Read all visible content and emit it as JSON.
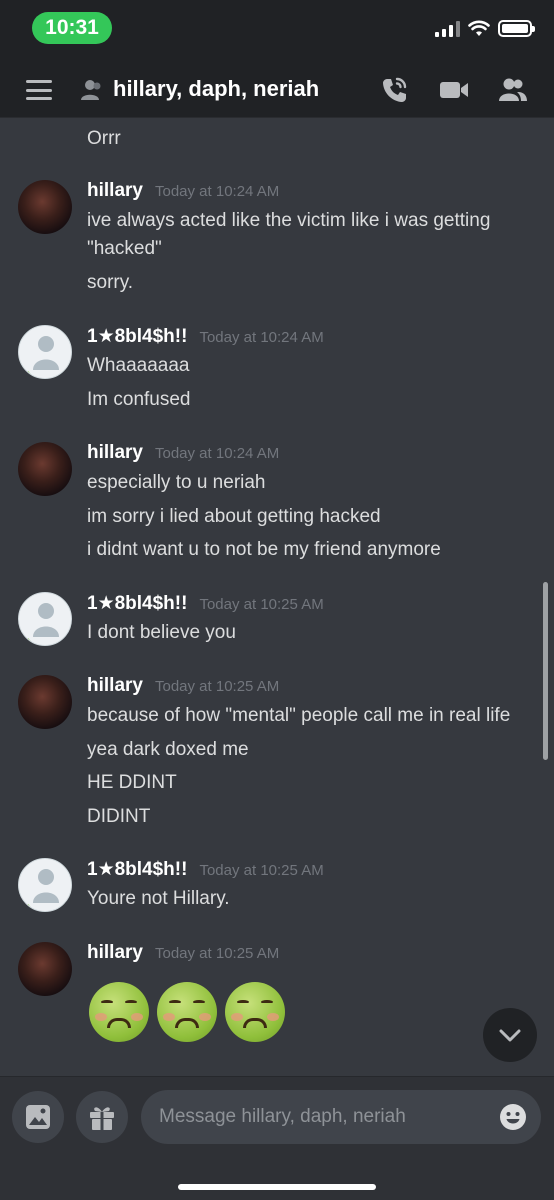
{
  "status_bar": {
    "time": "10:31"
  },
  "header": {
    "title": "hillary, daph, neriah"
  },
  "messages": {
    "continuation": "Orrr",
    "groups": [
      {
        "author": "hillary",
        "timestamp": "Today at 10:24 AM",
        "lines": [
          "ive always acted like the victim like i was getting",
          "\"hacked\"",
          "sorry."
        ]
      },
      {
        "author": "1★8bl4$h!!",
        "timestamp": "Today at 10:24 AM",
        "lines": [
          "Whaaaaaaa",
          "Im confused"
        ]
      },
      {
        "author": "hillary",
        "timestamp": "Today at 10:24 AM",
        "lines": [
          "especially to u neriah",
          "im sorry i lied about getting hacked",
          "i didnt want u to not be my friend anymore"
        ]
      },
      {
        "author": "1★8bl4$h!!",
        "timestamp": "Today at 10:25 AM",
        "lines": [
          "I dont believe you"
        ]
      },
      {
        "author": "hillary",
        "timestamp": "Today at 10:25 AM",
        "lines": [
          "because of how \"mental\" people call me in real life",
          "yea dark doxed me",
          "HE DDINT",
          "DIDINT"
        ]
      },
      {
        "author": "1★8bl4$h!!",
        "timestamp": "Today at 10:25 AM",
        "lines": [
          "Youre not Hillary."
        ]
      },
      {
        "author": "hillary",
        "timestamp": "Today at 10:25 AM",
        "emojis": [
          "nauseated-face",
          "nauseated-face",
          "nauseated-face"
        ]
      }
    ]
  },
  "composer": {
    "placeholder": "Message hillary, daph, neriah"
  },
  "colors": {
    "background": "#36393f",
    "header": "#202225",
    "status_green": "#34c759",
    "timestamp": "#72767d"
  }
}
